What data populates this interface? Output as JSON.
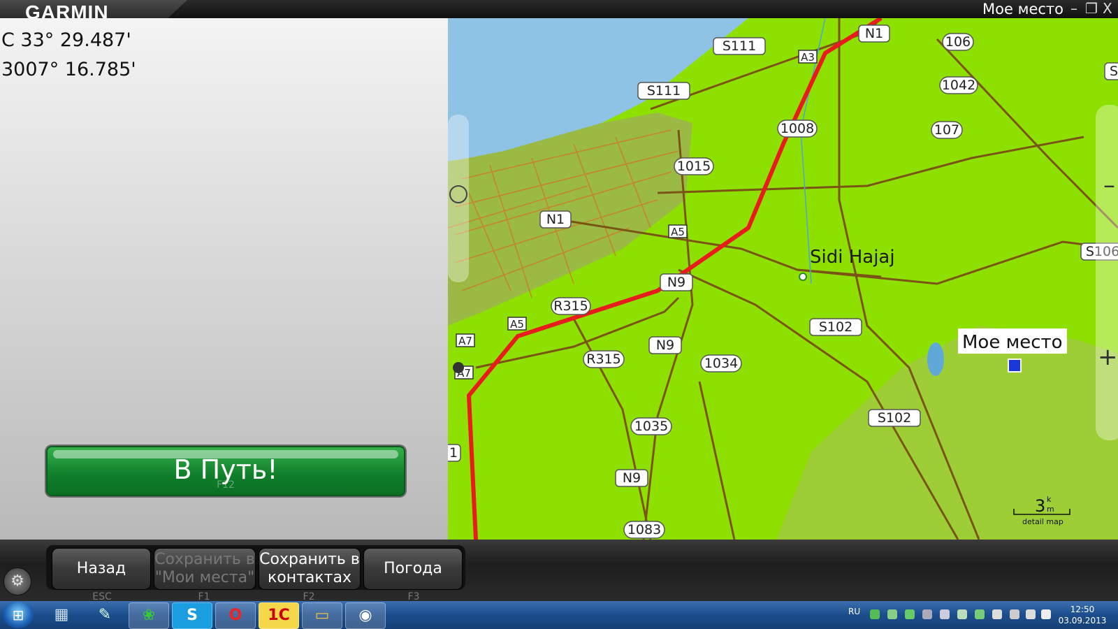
{
  "app": {
    "brand": "GARMIN",
    "window_title": "Мое место",
    "controls": {
      "minimize": "–",
      "restore": "❐",
      "close": "X"
    }
  },
  "location": {
    "lat": "С 33° 29.487'",
    "lon": "3007° 16.785'"
  },
  "go_button": {
    "label": "В Путь!",
    "hint": "F12"
  },
  "map": {
    "town": "Sidi Hajaj",
    "place_label": "Мое место",
    "scale_value": "3",
    "scale_unit_top": "k",
    "scale_unit_bottom": "m",
    "scale_caption": "detail map",
    "zoom_in": "+",
    "zoom_out": "–",
    "shields": [
      "N1",
      "S111",
      "S111",
      "106",
      "1042",
      "107",
      "1008",
      "1015",
      "N1",
      "N9",
      "R315",
      "N9",
      "R315",
      "1034",
      "1035",
      "N9",
      "S102",
      "S102",
      "S106",
      "1083",
      "1",
      "S"
    ],
    "autoroute": [
      "A3",
      "A5",
      "A5",
      "A7",
      "A7"
    ]
  },
  "toolbar": {
    "buttons": [
      {
        "label": "Назад",
        "key": "ESC",
        "enabled": true
      },
      {
        "label": "Сохранить в \"Мои места\"",
        "key": "F1",
        "enabled": false
      },
      {
        "label": "Сохранить в контактах",
        "key": "F2",
        "enabled": true
      },
      {
        "label": "Погода",
        "key": "F3",
        "enabled": true
      }
    ]
  },
  "taskbar": {
    "lang": "RU",
    "time": "12:50",
    "date": "03.09.2013",
    "apps": [
      "calculator",
      "notepad",
      "icq",
      "skype",
      "opera",
      "1c",
      "explorer",
      "garmin"
    ]
  },
  "colors": {
    "route": "#e81c1c",
    "land": "#8ee000",
    "water": "#8fc3e6",
    "go": "#0f7e2a"
  }
}
